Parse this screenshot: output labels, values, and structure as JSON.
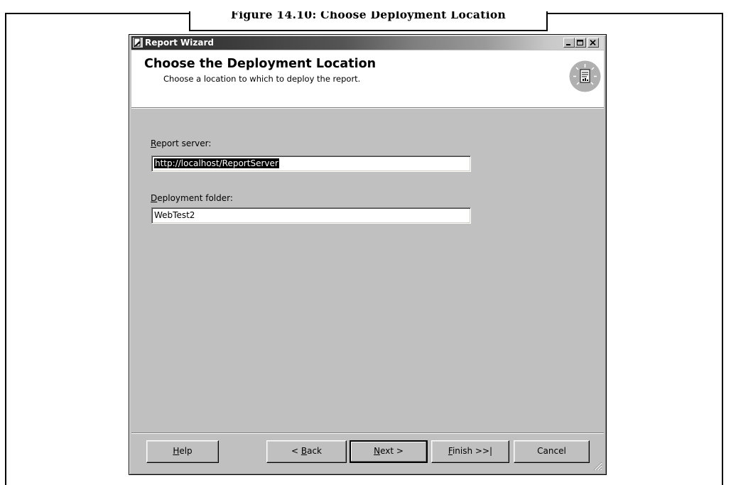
{
  "figure": {
    "caption": "Figure 14.10: Choose Deployment Location"
  },
  "window": {
    "title": "Report Wizard",
    "controls": {
      "minimize": "minimize-icon",
      "maximize": "maximize-icon",
      "close": "close-icon"
    }
  },
  "header": {
    "title": "Choose the Deployment Location",
    "subtitle": "Choose a location to which to deploy the report.",
    "icon": "report-wizard-icon"
  },
  "fields": {
    "report_server": {
      "label_access": "R",
      "label_rest": "eport server:",
      "value": "http://localhost/ReportServer"
    },
    "deployment_folder": {
      "label_access": "D",
      "label_rest": "eployment folder:",
      "value": "WebTest2"
    }
  },
  "buttons": {
    "help": {
      "access": "H",
      "rest": "elp"
    },
    "back": {
      "prefix": "< ",
      "access": "B",
      "rest": "ack"
    },
    "next": {
      "access": "N",
      "rest": "ext >"
    },
    "finish": {
      "access": "F",
      "rest": "inish >>|"
    },
    "cancel": {
      "label": "Cancel"
    }
  }
}
